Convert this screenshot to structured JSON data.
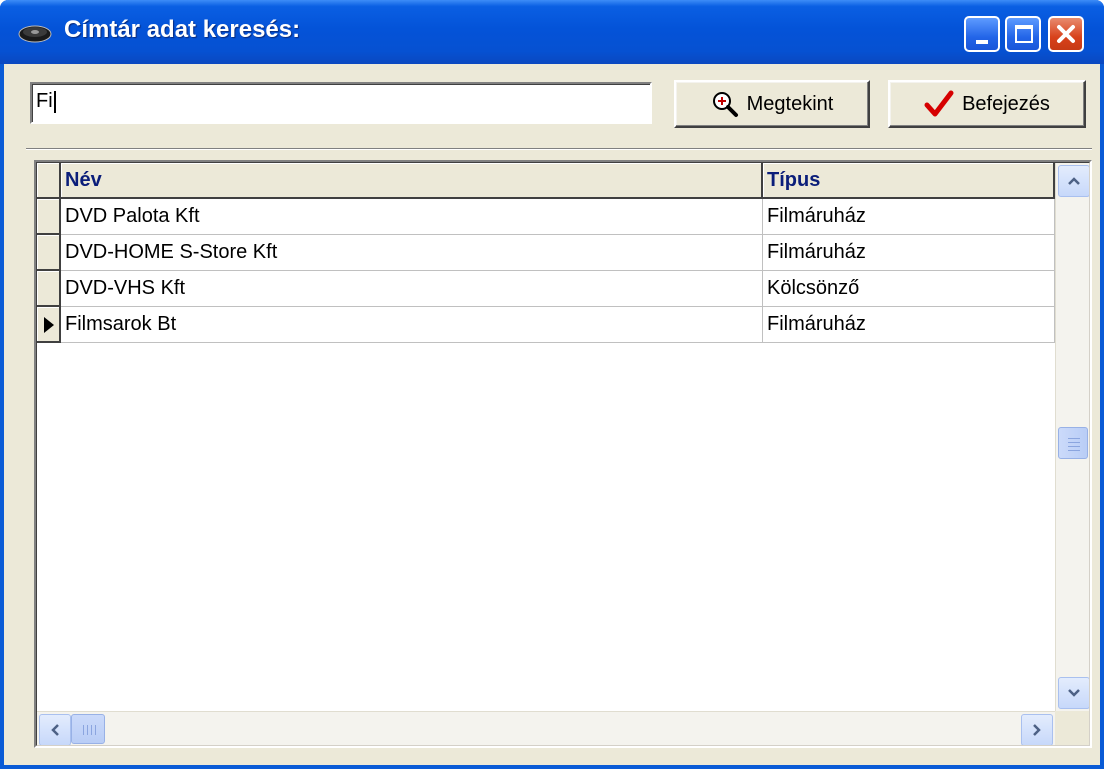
{
  "window": {
    "title": "Címtár adat keresés:",
    "controls": {
      "minimize": "minimize",
      "maximize": "maximize",
      "close": "close"
    }
  },
  "search": {
    "value": "Fi"
  },
  "buttons": {
    "view_label": "Megtekint",
    "view_icon": "magnifier-icon",
    "done_label": "Befejezés",
    "done_icon": "checkmark-icon"
  },
  "table": {
    "columns": [
      "Név",
      "Típus"
    ],
    "rows": [
      {
        "name": "DVD Palota Kft",
        "type": "Filmáruház",
        "current": false
      },
      {
        "name": "DVD-HOME S-Store Kft",
        "type": "Filmáruház",
        "current": false
      },
      {
        "name": "DVD-VHS Kft",
        "type": "Kölcsönző",
        "current": false
      },
      {
        "name": "Filmsarok Bt",
        "type": "Filmáruház",
        "current": true
      }
    ]
  },
  "colors": {
    "title_bar": "#0453d8",
    "header_text": "#0b1e7a",
    "close_button": "#d8411b",
    "check_mark": "#d60000"
  }
}
